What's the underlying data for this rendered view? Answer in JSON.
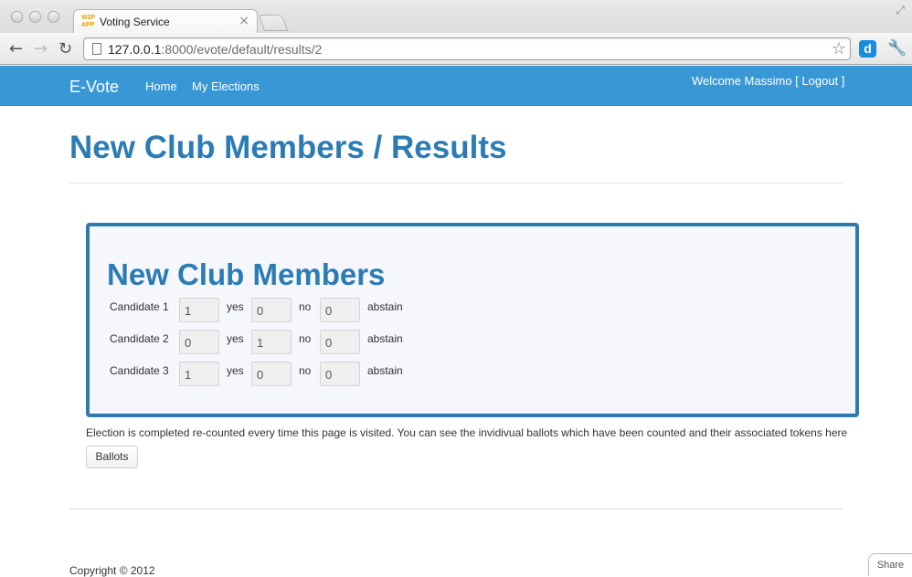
{
  "browser": {
    "tab_title": "Voting Service",
    "favicon_text": "W2P APP",
    "url_host": "127.0.0.1",
    "url_rest": ":8000/evote/default/results/2"
  },
  "navbar": {
    "brand": "E-Vote",
    "links": [
      "Home",
      "My Elections"
    ],
    "welcome": "Welcome Massimo [ Logout ]",
    "color": "#3898d6"
  },
  "page": {
    "title": "New Club Members / Results"
  },
  "ballot": {
    "title": "New Club Members",
    "option_labels": [
      "yes",
      "no",
      "abstain"
    ],
    "candidates": [
      {
        "name": "Candidate 1",
        "yes": "1",
        "no": "0",
        "abstain": "0"
      },
      {
        "name": "Candidate 2",
        "yes": "0",
        "no": "1",
        "abstain": "0"
      },
      {
        "name": "Candidate 3",
        "yes": "1",
        "no": "0",
        "abstain": "0"
      }
    ]
  },
  "note": "Election is completed re-counted every time this page is visited. You can see the invidivual ballots which have been counted and their associated tokens here",
  "ballots_button": "Ballots",
  "footer": {
    "copyright": "Copyright © 2012",
    "share": "Share"
  }
}
